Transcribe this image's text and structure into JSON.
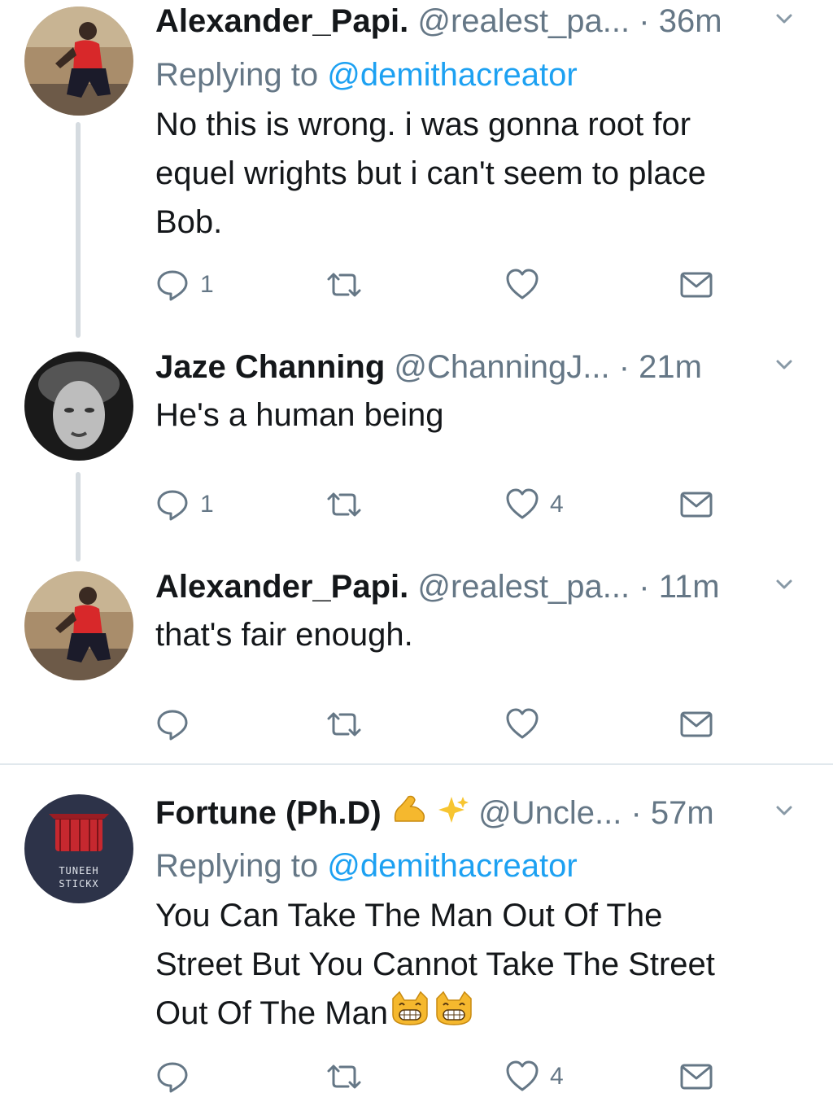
{
  "tweets": [
    {
      "name": "Alexander_Papi.",
      "handle": "@realest_pa...",
      "time": "36m",
      "reply_prefix": "Replying to",
      "reply_to": "@demithacreator",
      "lines": [
        "No this is wrong. i was gonna root for",
        "equel wrights but i can't seem to place",
        "Bob."
      ],
      "reply_count": "1",
      "like_count": ""
    },
    {
      "name": "Jaze Channing",
      "handle": "@ChanningJ...",
      "time": "21m",
      "lines": [
        "He's a human being"
      ],
      "reply_count": "1",
      "like_count": "4"
    },
    {
      "name": "Alexander_Papi.",
      "handle": "@realest_pa...",
      "time": "11m",
      "lines": [
        "that's fair enough."
      ],
      "reply_count": "",
      "like_count": ""
    },
    {
      "name": "Fortune (Ph.D)",
      "name_emojis": [
        "flexed-biceps",
        "sparkles"
      ],
      "handle": "@Uncle...",
      "time": "57m",
      "reply_prefix": "Replying to",
      "reply_to": "@demithacreator",
      "lines": [
        "You Can Take The Man Out Of The",
        "Street But You Cannot Take The Street",
        "Out Of The Man"
      ],
      "line_emojis": [
        "grinning-cat",
        "grinning-cat"
      ],
      "avatar_text": [
        "TUNEEH",
        "STICKX"
      ],
      "reply_count": "",
      "like_count": "4"
    }
  ],
  "separator": "·",
  "icons": {
    "reply": "reply-bubble-icon",
    "retweet": "retweet-icon",
    "like": "heart-icon",
    "dm": "envelope-icon",
    "caret": "chevron-down-icon"
  },
  "colors": {
    "name": "#14171a",
    "meta": "#657786",
    "link": "#1da1f2",
    "thread_line": "#d5dbe0"
  }
}
